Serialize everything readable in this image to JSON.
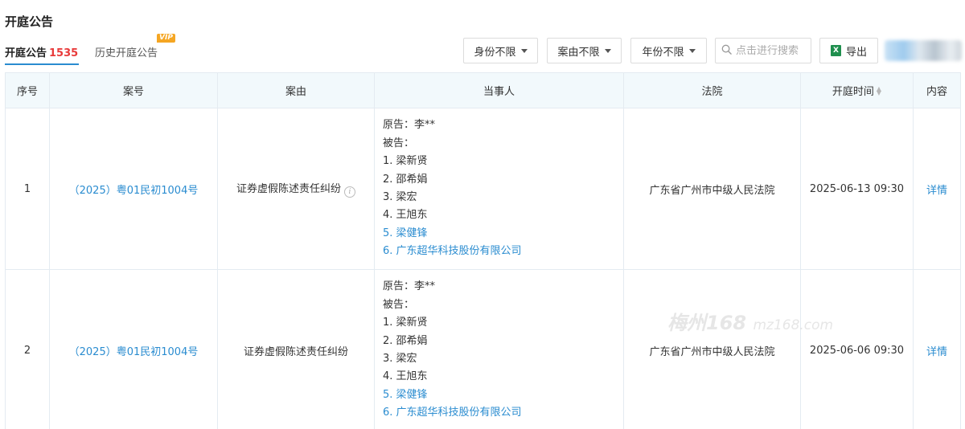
{
  "page": {
    "title": "开庭公告"
  },
  "tabs": {
    "current_label": "开庭公告",
    "current_count": "1535",
    "history_label": "历史开庭公告",
    "history_badge": "VIP"
  },
  "filters": {
    "identity": "身份不限",
    "cause": "案由不限",
    "year": "年份不限",
    "search_placeholder": "点击进行搜索",
    "export_label": "导出"
  },
  "table": {
    "headers": {
      "index": "序号",
      "case_no": "案号",
      "cause": "案由",
      "parties": "当事人",
      "court": "法院",
      "time": "开庭时间",
      "content": "内容"
    },
    "rows": [
      {
        "index": "1",
        "case_no": "（2025）粤01民初1004号",
        "cause": "证券虚假陈述责任纠纷",
        "plaintiff": "原告：李**",
        "defendant_label": "被告：",
        "defendants": [
          "1. 梁新贤",
          "2. 邵希娟",
          "3. 梁宏",
          "4. 王旭东"
        ],
        "defendants_linked": [
          "5. 梁健锋",
          "6. 广东超华科技股份有限公司"
        ],
        "court": "广东省广州市中级人民法院",
        "time": "2025-06-13 09:30",
        "detail": "详情"
      },
      {
        "index": "2",
        "case_no": "（2025）粤01民初1004号",
        "cause": "证券虚假陈述责任纠纷",
        "plaintiff": "原告：李**",
        "defendant_label": "被告：",
        "defendants": [
          "1. 梁新贤",
          "2. 邵希娟",
          "3. 梁宏",
          "4. 王旭东"
        ],
        "defendants_linked": [
          "5. 梁健锋",
          "6. 广东超华科技股份有限公司"
        ],
        "court": "广东省广州市中级人民法院",
        "time": "2025-06-06 09:30",
        "detail": "详情"
      }
    ]
  },
  "watermark": {
    "text": "梅州168",
    "domain": "mz168.com"
  },
  "icons": {
    "search": "search-icon",
    "excel": "excel-icon",
    "caret": "caret-down-icon",
    "info": "info-icon",
    "sort": "sort-icon"
  },
  "colors": {
    "link": "#2a8cd0",
    "count": "#e83a3a",
    "header_bg": "#f2f9fc",
    "vip": "#f5a623"
  }
}
